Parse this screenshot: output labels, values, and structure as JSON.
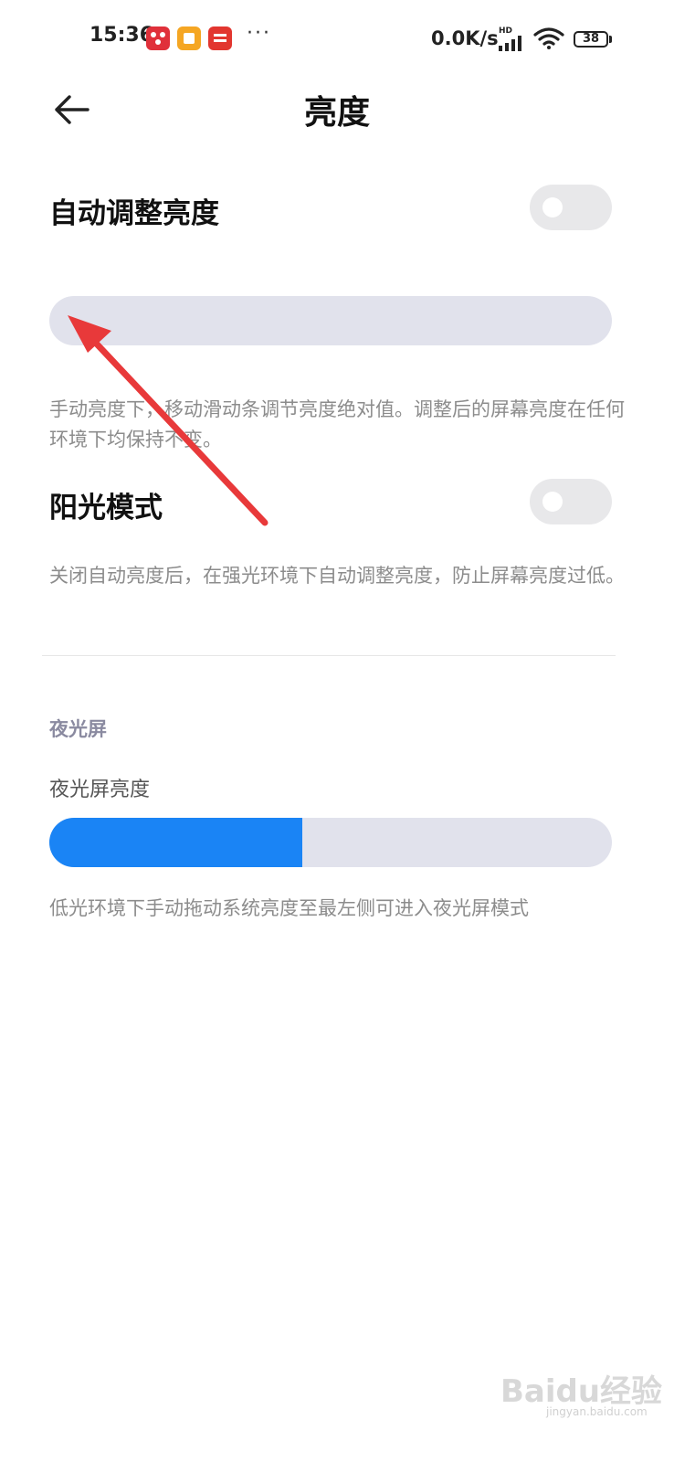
{
  "status_bar": {
    "time": "15:36",
    "net_speed": "0.0K/s",
    "signal_badge": "HD",
    "battery_level": "38",
    "more_indicator": "···",
    "notification_icons": [
      "app-red-pattern-icon",
      "app-yellow-icon",
      "app-youpin-icon"
    ]
  },
  "header": {
    "title": "亮度",
    "back_icon": "arrow-left-icon"
  },
  "auto_brightness": {
    "label": "自动调整亮度",
    "enabled": false
  },
  "brightness_slider": {
    "level": 0,
    "description": "手动亮度下，移动滑动条调节亮度绝对值。调整后的屏幕亮度在任何环境下均保持不变。"
  },
  "sunlight_mode": {
    "label": "阳光模式",
    "enabled": false,
    "description": "关闭自动亮度后，在强光环境下自动调整亮度，防止屏幕亮度过低。"
  },
  "night_light": {
    "section_title": "夜光屏",
    "slider_label": "夜光屏亮度",
    "level": 0.45,
    "description": "低光环境下手动拖动系统亮度至最左侧可进入夜光屏模式"
  },
  "colors": {
    "accent": "#1a84f5",
    "slider_track": "#e1e2ec",
    "toggle_off": "#e8e8ea",
    "annotation_arrow": "#e8393a"
  },
  "watermark": {
    "text": "Baidu经验",
    "sub": "jingyan.baidu.com"
  }
}
